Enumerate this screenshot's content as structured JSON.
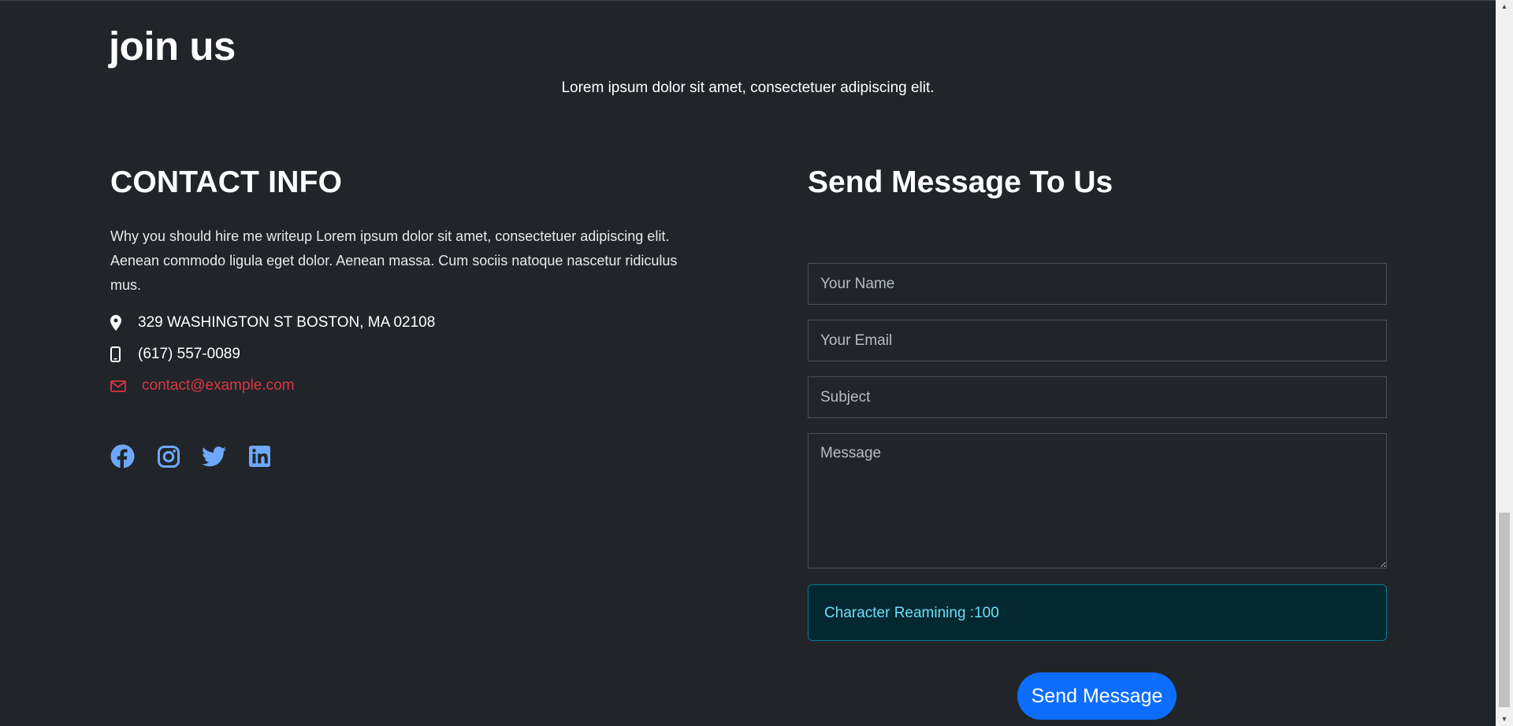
{
  "section": {
    "title": "join us",
    "subtitle": "Lorem ipsum dolor sit amet, consectetuer adipiscing elit."
  },
  "contact": {
    "title": "CONTACT INFO",
    "text": "Why you should hire me writeup Lorem ipsum dolor sit amet, consectetuer adipiscing elit. Aenean commodo ligula eget dolor. Aenean massa. Cum sociis natoque nascetur ridiculus mus.",
    "address": "329 WASHINGTON ST BOSTON, MA 02108",
    "phone": "(617) 557-0089",
    "email": "contact@example.com",
    "socials": [
      "facebook-icon",
      "instagram-icon",
      "twitter-icon",
      "linkedin-icon"
    ]
  },
  "form": {
    "title": "Send Message To Us",
    "name_placeholder": "Your Name",
    "email_placeholder": "Your Email",
    "subject_placeholder": "Subject",
    "message_placeholder": "Message",
    "char_remaining": "Character Reamining :100",
    "submit_label": "Send Message"
  },
  "colors": {
    "background": "#212529",
    "link": "#dc3545",
    "social": "#6ea8fe",
    "primary": "#0d6efd",
    "alert_bg": "#032830",
    "alert_text": "#6edff6"
  },
  "scrollbar": {
    "position": 0.7
  }
}
